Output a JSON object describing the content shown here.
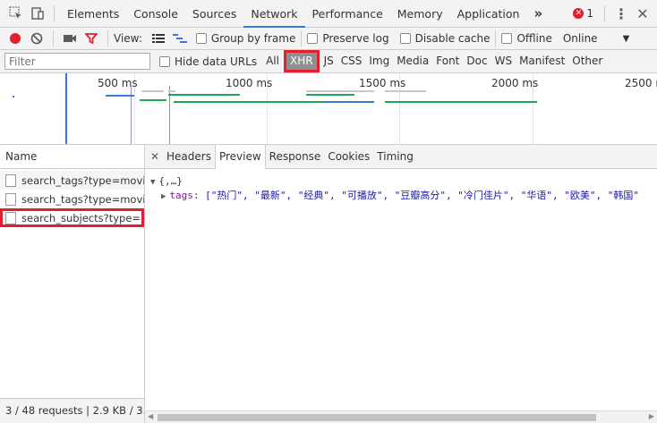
{
  "topbar": {
    "tabs": [
      "Elements",
      "Console",
      "Sources",
      "Network",
      "Performance",
      "Memory",
      "Application"
    ],
    "active_tab": "Network",
    "more": "»",
    "error_count": "1"
  },
  "toolbar": {
    "view_label": "View:",
    "group_by_frame": "Group by frame",
    "preserve_log": "Preserve log",
    "disable_cache": "Disable cache",
    "offline": "Offline",
    "throttle": "Online"
  },
  "filterbar": {
    "placeholder": "Filter",
    "hide_data_urls": "Hide data URLs",
    "types": [
      "All",
      "XHR",
      "JS",
      "CSS",
      "Img",
      "Media",
      "Font",
      "Doc",
      "WS",
      "Manifest",
      "Other"
    ],
    "active_type": "XHR"
  },
  "overview": {
    "ticks": [
      "500 ms",
      "1000 ms",
      "1500 ms",
      "2000 ms",
      "2500 r"
    ]
  },
  "sidebar": {
    "header": "Name",
    "requests": [
      "search_tags?type=movi...",
      "search_tags?type=movi...",
      "search_subjects?type=..."
    ],
    "status": "3 / 48 requests | 2.9 KB / 3..."
  },
  "detail": {
    "tabs": [
      "Headers",
      "Preview",
      "Response",
      "Cookies",
      "Timing"
    ],
    "active_tab": "Preview",
    "root": "{,…}",
    "key": "tags",
    "value": "[\"热门\", \"最新\", \"经典\", \"可播放\", \"豆瓣高分\", \"冷门佳片\", \"华语\", \"欧美\", \"韩国\""
  },
  "colors": {
    "accent": "#3879d9",
    "highlight": "#e0202e",
    "record": "#e0202e"
  }
}
